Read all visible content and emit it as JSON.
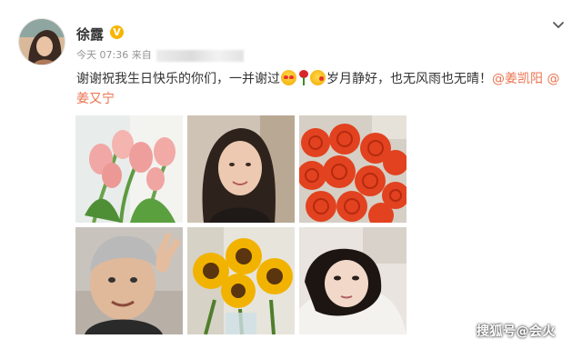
{
  "post": {
    "username": "徐露",
    "verified_badge": "V",
    "time": "今天 07:36",
    "source_label": "来自",
    "text_main": "谢谢祝我生日快乐的你们，一并谢过",
    "text_after_emoji": "岁月静好，也无风雨也无晴！",
    "mentions": [
      "@姜凯阳",
      "@姜又宁"
    ],
    "emoji_icons": [
      "heart-eyes-icon",
      "rose-icon",
      "kiss-face-icon"
    ],
    "images": [
      {
        "name": "tulips-photo"
      },
      {
        "name": "woman-selfie-photo"
      },
      {
        "name": "roses-photo"
      },
      {
        "name": "man-selfie-photo"
      },
      {
        "name": "sunflowers-photo"
      },
      {
        "name": "girl-selfie-photo"
      }
    ]
  },
  "watermark": "搜狐号@会火",
  "colors": {
    "mention": "#eb7350",
    "meta_text": "#939393",
    "verified": "#f7b500"
  }
}
